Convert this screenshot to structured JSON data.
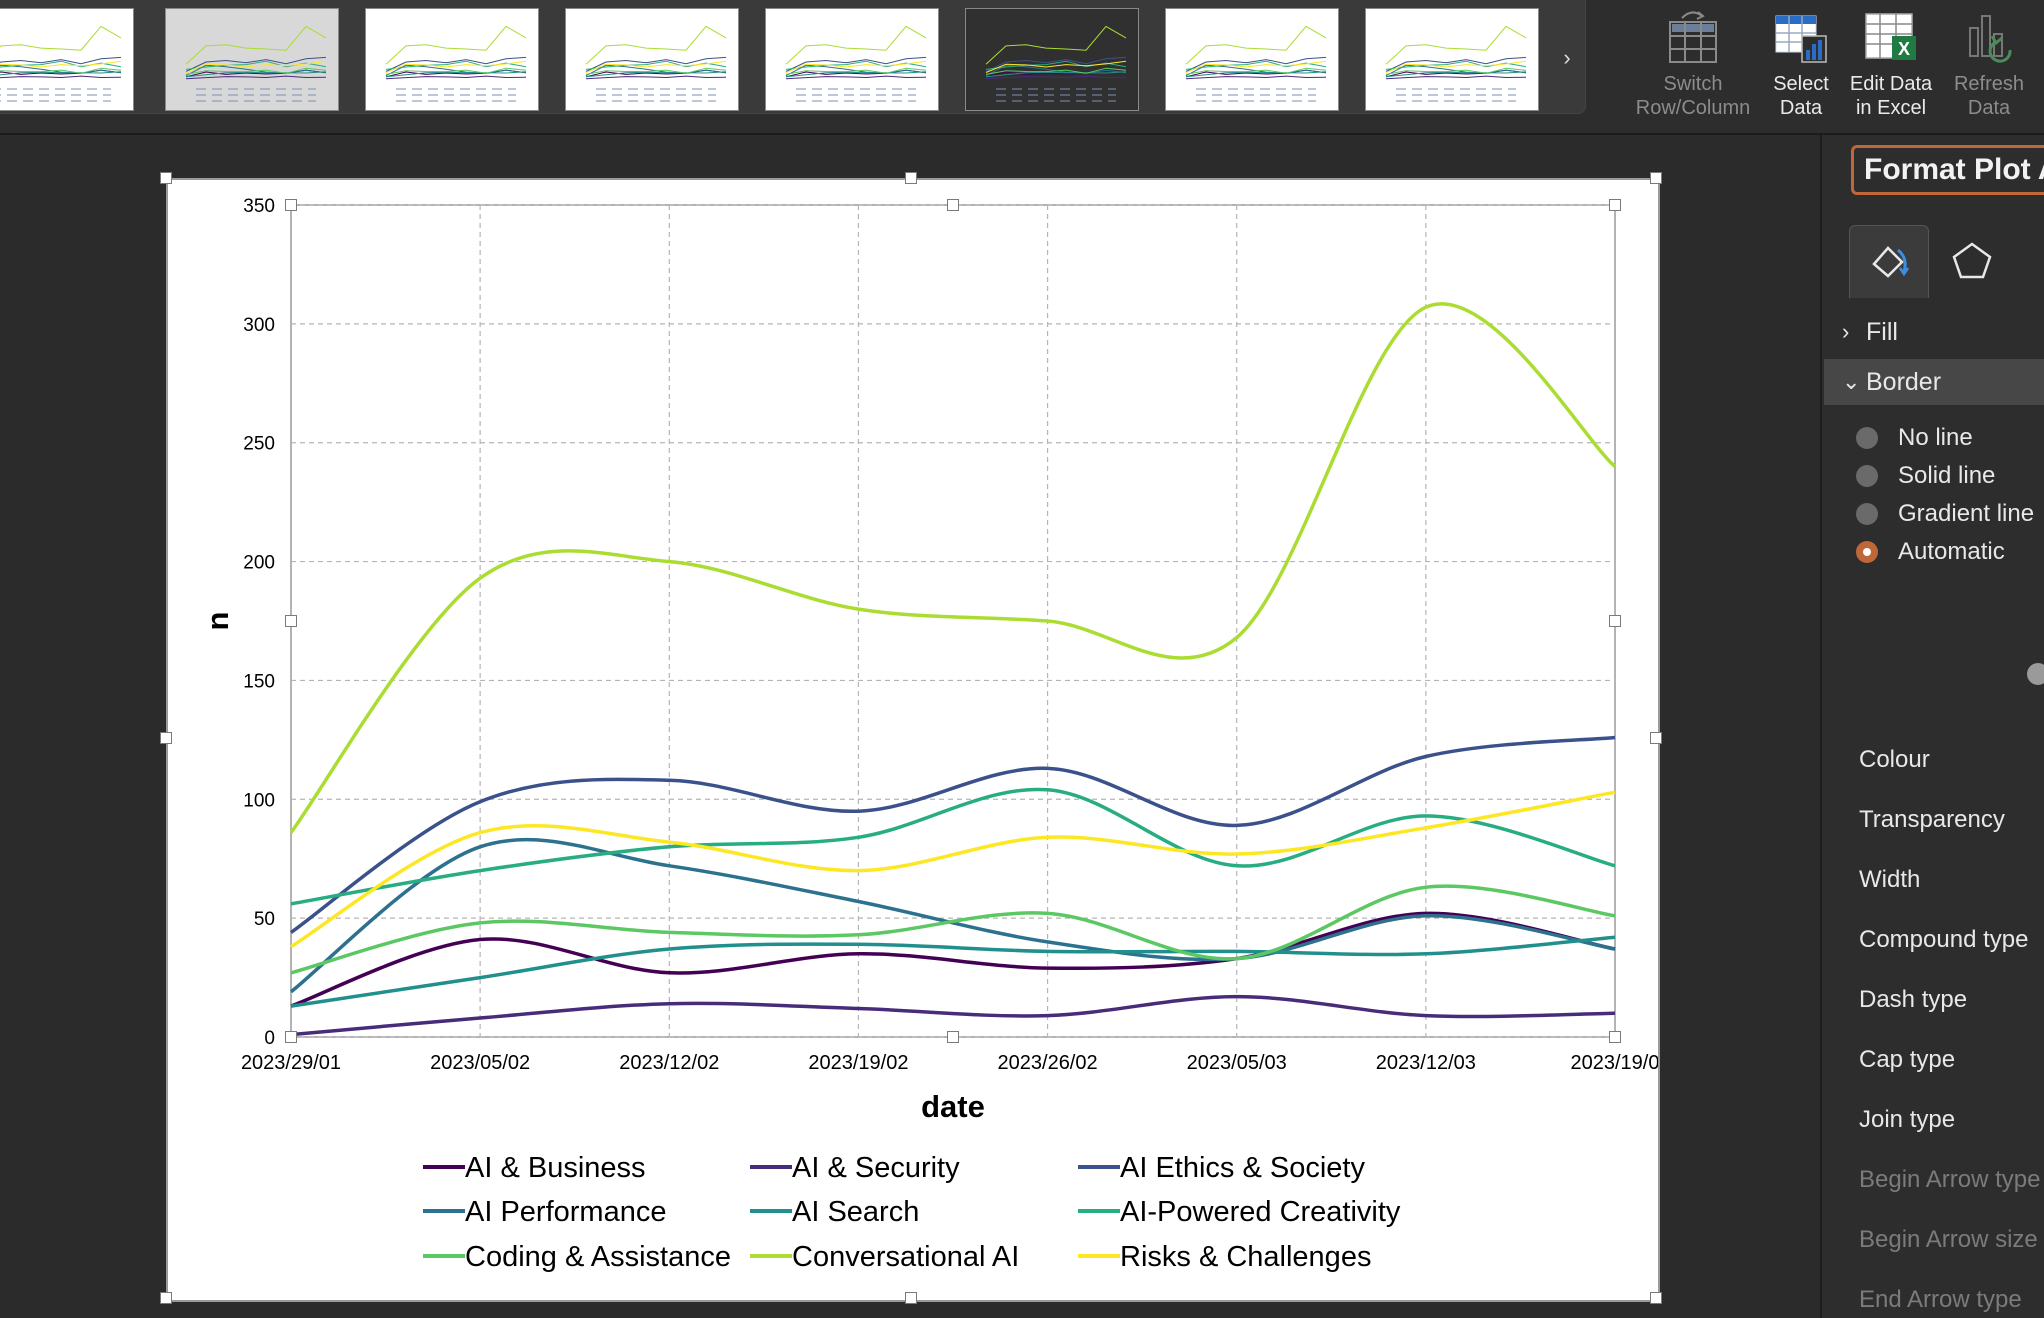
{
  "ribbon": {
    "chart_styles": [
      {
        "name": "chart-style-1",
        "style": "light"
      },
      {
        "name": "chart-style-2",
        "style": "selected"
      },
      {
        "name": "chart-style-3",
        "style": "light"
      },
      {
        "name": "chart-style-4",
        "style": "light"
      },
      {
        "name": "chart-style-5",
        "style": "light"
      },
      {
        "name": "chart-style-6",
        "style": "dark"
      },
      {
        "name": "chart-style-7",
        "style": "light"
      },
      {
        "name": "chart-style-8",
        "style": "light"
      }
    ],
    "gallery_next_glyph": "›",
    "switch_row_column": {
      "line1": "Switch",
      "line2": "Row/Column"
    },
    "select_data": {
      "line1": "Select",
      "line2": "Data"
    },
    "edit_data_in_excel": {
      "line1": "Edit Data",
      "line2": "in Excel"
    },
    "refresh_data": {
      "line1": "Refresh",
      "line2": "Data"
    }
  },
  "pane": {
    "title": "Format Plot A",
    "tabs": [
      {
        "icon": "paint-bucket-icon"
      },
      {
        "icon": "pentagon-icon"
      }
    ],
    "fill_label": "Fill",
    "border_label": "Border",
    "border_options": [
      {
        "label": "No line",
        "checked": false
      },
      {
        "label": "Solid line",
        "checked": false
      },
      {
        "label": "Gradient line",
        "checked": false
      },
      {
        "label": "Automatic",
        "checked": true
      }
    ],
    "properties": [
      {
        "label": "Colour",
        "enabled": true
      },
      {
        "label": "Transparency",
        "enabled": true
      },
      {
        "label": "Width",
        "enabled": true
      },
      {
        "label": "Compound type",
        "enabled": true
      },
      {
        "label": "Dash type",
        "enabled": true
      },
      {
        "label": "Cap type",
        "enabled": true
      },
      {
        "label": "Join type",
        "enabled": true
      },
      {
        "label": "Begin Arrow type",
        "enabled": false
      },
      {
        "label": "Begin Arrow size",
        "enabled": false
      },
      {
        "label": "End Arrow type",
        "enabled": false
      },
      {
        "label": "End Arrow size",
        "enabled": false
      }
    ],
    "accent_color": "#c0673a"
  },
  "chart_data": {
    "type": "line",
    "smooth": true,
    "x": [
      "2023/29/01",
      "2023/05/02",
      "2023/12/02",
      "2023/19/02",
      "2023/26/02",
      "2023/05/03",
      "2023/12/03",
      "2023/19/0"
    ],
    "xlabel": "date",
    "ylabel": "n",
    "ylim": [
      0,
      350
    ],
    "yticks": [
      0,
      50,
      100,
      150,
      200,
      250,
      300,
      350
    ],
    "grid": true,
    "legend_position": "bottom",
    "series": [
      {
        "name": "AI & Business",
        "color": "#440154",
        "values": [
          13,
          41,
          27,
          35,
          29,
          33,
          52,
          37
        ]
      },
      {
        "name": "AI & Security",
        "color": "#472c7a",
        "values": [
          1,
          8,
          14,
          12,
          9,
          17,
          9,
          10
        ]
      },
      {
        "name": "AI Ethics & Society",
        "color": "#3b518b",
        "values": [
          44,
          99,
          108,
          95,
          113,
          89,
          118,
          126
        ]
      },
      {
        "name": "AI Performance",
        "color": "#2c718e",
        "values": [
          19,
          80,
          72,
          57,
          40,
          33,
          51,
          37
        ]
      },
      {
        "name": "AI Search",
        "color": "#21908d",
        "values": [
          13,
          25,
          37,
          39,
          36,
          36,
          35,
          42
        ]
      },
      {
        "name": "AI-Powered Creativity",
        "color": "#27ad81",
        "values": [
          56,
          70,
          80,
          84,
          104,
          72,
          93,
          72
        ]
      },
      {
        "name": "Coding & Assistance",
        "color": "#5cc863",
        "values": [
          27,
          48,
          44,
          43,
          52,
          33,
          63,
          51
        ]
      },
      {
        "name": "Conversational AI",
        "color": "#aadc32",
        "values": [
          86,
          193,
          200,
          180,
          175,
          168,
          307,
          240
        ]
      },
      {
        "name": "Risks & Challenges",
        "color": "#fde725",
        "values": [
          38,
          86,
          82,
          70,
          84,
          77,
          88,
          103
        ]
      }
    ]
  }
}
